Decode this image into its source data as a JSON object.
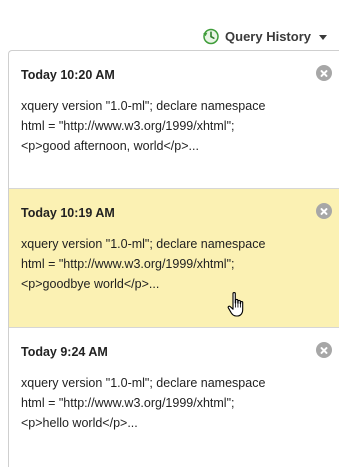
{
  "header": {
    "query_history_label": "Query History"
  },
  "history": [
    {
      "time": "Today 10:20 AM",
      "lines": [
        "xquery version \"1.0-ml\"; declare namespace",
        "html = \"http://www.w3.org/1999/xhtml\";",
        "<p>good afternoon, world</p>..."
      ]
    },
    {
      "time": "Today 10:19 AM",
      "lines": [
        "xquery version \"1.0-ml\"; declare namespace",
        "html = \"http://www.w3.org/1999/xhtml\";",
        "<p>goodbye world</p>..."
      ]
    },
    {
      "time": "Today 9:24 AM",
      "lines": [
        "xquery version \"1.0-ml\"; declare namespace",
        "html = \"http://www.w3.org/1999/xhtml\";",
        "<p>hello world</p>..."
      ]
    }
  ],
  "colors": {
    "highlight": "#fbf1b3",
    "icon_green": "#3f9d3a"
  },
  "icons": {
    "history": "history-icon",
    "dropdown": "caret-down-icon",
    "close": "close-icon",
    "cursor": "hand-pointer-icon"
  }
}
